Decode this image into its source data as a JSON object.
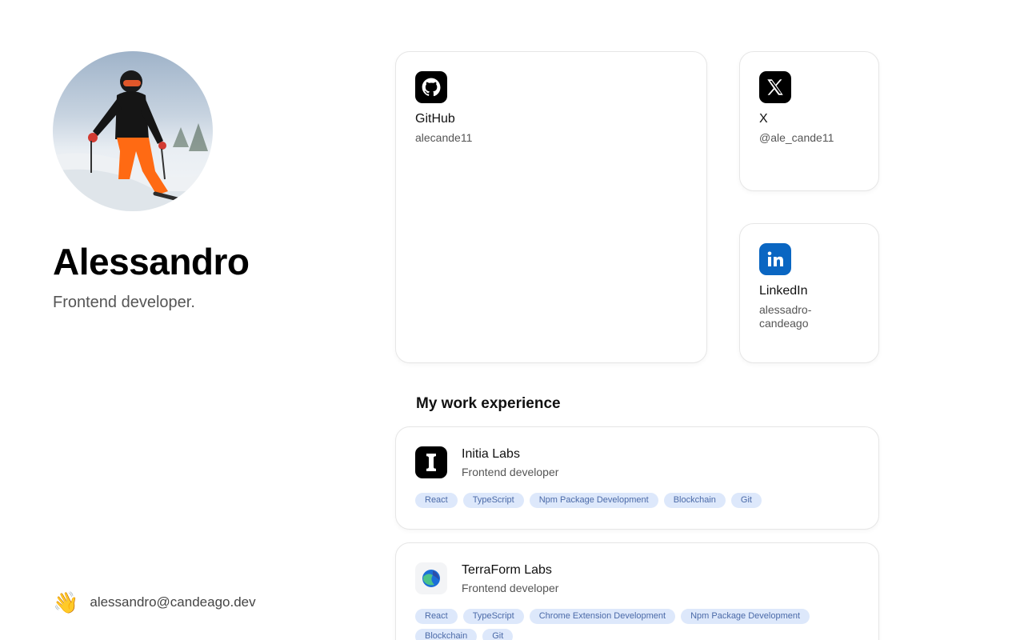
{
  "profile": {
    "name": "Alessandro",
    "tagline": "Frontend developer.",
    "contact_emoji": "👋",
    "email": "alessandro@candeago.dev"
  },
  "social": {
    "github": {
      "title": "GitHub",
      "handle": "alecande11",
      "icon": "github-icon",
      "color": "#000000"
    },
    "x": {
      "title": "X",
      "handle": "@ale_cande11",
      "icon": "x-icon",
      "color": "#000000"
    },
    "linkedin": {
      "title": "LinkedIn",
      "handle": "alessadro-candeago",
      "icon": "linkedin-icon",
      "color": "#0a66c2"
    }
  },
  "experience": {
    "title": "My work experience",
    "items": [
      {
        "company": "Initia Labs",
        "role": "Frontend developer",
        "tags": [
          "React",
          "TypeScript",
          "Npm Package Development",
          "Blockchain",
          "Git"
        ]
      },
      {
        "company": "TerraForm Labs",
        "role": "Frontend developer",
        "tags": [
          "React",
          "TypeScript",
          "Chrome Extension Development",
          "Npm Package Development",
          "Blockchain",
          "Git"
        ]
      }
    ]
  },
  "colors": {
    "tag_bg": "#dde8fb",
    "tag_text": "#4b6aa8",
    "muted_text": "#555555"
  }
}
